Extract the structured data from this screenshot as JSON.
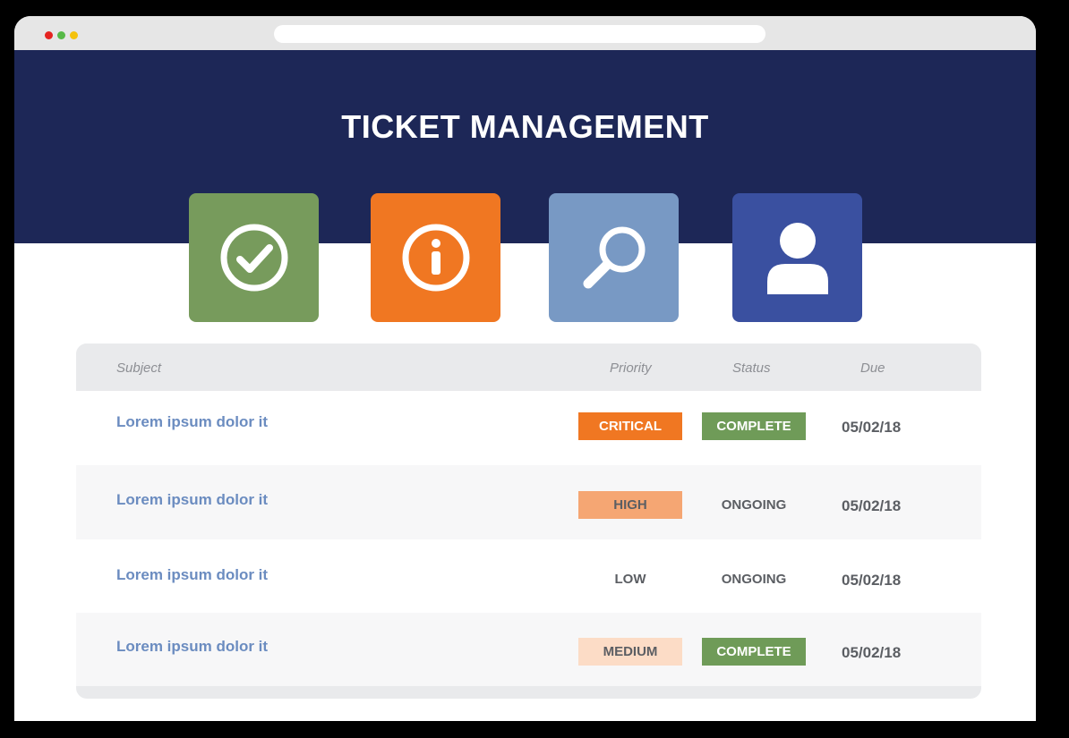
{
  "browser": {
    "window_dots": [
      "red",
      "green",
      "yellow"
    ]
  },
  "header": {
    "title": "TICKET MANAGEMENT"
  },
  "tiles": [
    {
      "icon": "check-circle-icon",
      "color": "#779b5c"
    },
    {
      "icon": "info-icon",
      "color": "#f07722"
    },
    {
      "icon": "search-icon",
      "color": "#7899c4"
    },
    {
      "icon": "user-icon",
      "color": "#3a50a0"
    }
  ],
  "table": {
    "columns": {
      "subject": "Subject",
      "priority": "Priority",
      "status": "Status",
      "due": "Due"
    },
    "rows": [
      {
        "subject": "Lorem ipsum dolor it",
        "priority": "CRITICAL",
        "status": "COMPLETE",
        "due": "05/02/18"
      },
      {
        "subject": "Lorem ipsum dolor it",
        "priority": "HIGH",
        "status": "ONGOING",
        "due": "05/02/18"
      },
      {
        "subject": "Lorem ipsum dolor it",
        "priority": "LOW",
        "status": "ONGOING",
        "due": "05/02/18"
      },
      {
        "subject": "Lorem ipsum dolor it",
        "priority": "MEDIUM",
        "status": "COMPLETE",
        "due": "05/02/18"
      }
    ]
  },
  "colors": {
    "banner": "#1d2757",
    "critical": "#f07722",
    "high": "#f5a673",
    "medium": "#fcdcc6",
    "complete": "#6f9b58",
    "subject_link": "#6b8cc0"
  }
}
